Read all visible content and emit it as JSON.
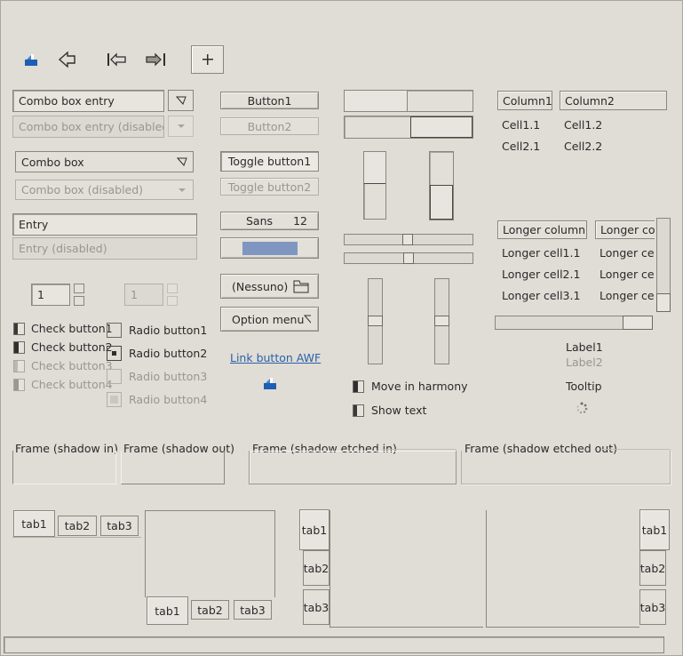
{
  "toolbar": {
    "items": [
      {
        "icon": "home-icon"
      },
      {
        "icon": "back-arrow-icon"
      },
      {
        "icon": "goto-first-icon"
      },
      {
        "icon": "goto-last-icon"
      },
      {
        "icon": "add-icon"
      }
    ]
  },
  "combos": {
    "entry": "Combo box entry",
    "entry_disabled": "Combo box entry (disabled)",
    "box": "Combo box",
    "box_disabled": "Combo box (disabled)"
  },
  "entries": {
    "entry": "Entry",
    "entry_disabled": "Entry (disabled)"
  },
  "spin": {
    "value": "1",
    "value_disabled": "1"
  },
  "checks": [
    "Check button1",
    "Check button2",
    "Check button3",
    "Check button4"
  ],
  "radios": [
    "Radio button1",
    "Radio button2",
    "Radio button3",
    "Radio button4"
  ],
  "buttons": {
    "button1": "Button1",
    "button2": "Button2",
    "toggle1": "Toggle button1",
    "toggle2": "Toggle button2",
    "font_name": "Sans",
    "font_size": "12",
    "file_chooser": "(Nessuno)",
    "option_menu": "Option menu",
    "link": "Link button AWF"
  },
  "harmony": {
    "move_label": "Move in harmony",
    "show_text": "Show text"
  },
  "tree1": {
    "columns": [
      "Column1",
      "Column2"
    ],
    "rows": [
      [
        "Cell1.1",
        "Cell1.2"
      ],
      [
        "Cell2.1",
        "Cell2.2"
      ]
    ]
  },
  "tree2": {
    "columns": [
      "Longer column1",
      "Longer colu"
    ],
    "rows": [
      [
        "Longer cell1.1",
        "Longer cell"
      ],
      [
        "Longer cell2.1",
        "Longer cell"
      ],
      [
        "Longer cell3.1",
        "Longer cell"
      ]
    ]
  },
  "labels": {
    "label1": "Label1",
    "label2": "Label2",
    "tooltip": "Tooltip"
  },
  "frames": {
    "shadow_in": "Frame (shadow in)",
    "shadow_out": "Frame (shadow out)",
    "etched_in": "Frame (shadow etched in)",
    "etched_out": "Frame (shadow etched out)"
  },
  "tabs": [
    "tab1",
    "tab2",
    "tab3"
  ],
  "colors": {
    "background": "#e0dcd6",
    "border": "#8a867f",
    "progress_fill": "#7f97c0",
    "link": "#2a62a8"
  }
}
